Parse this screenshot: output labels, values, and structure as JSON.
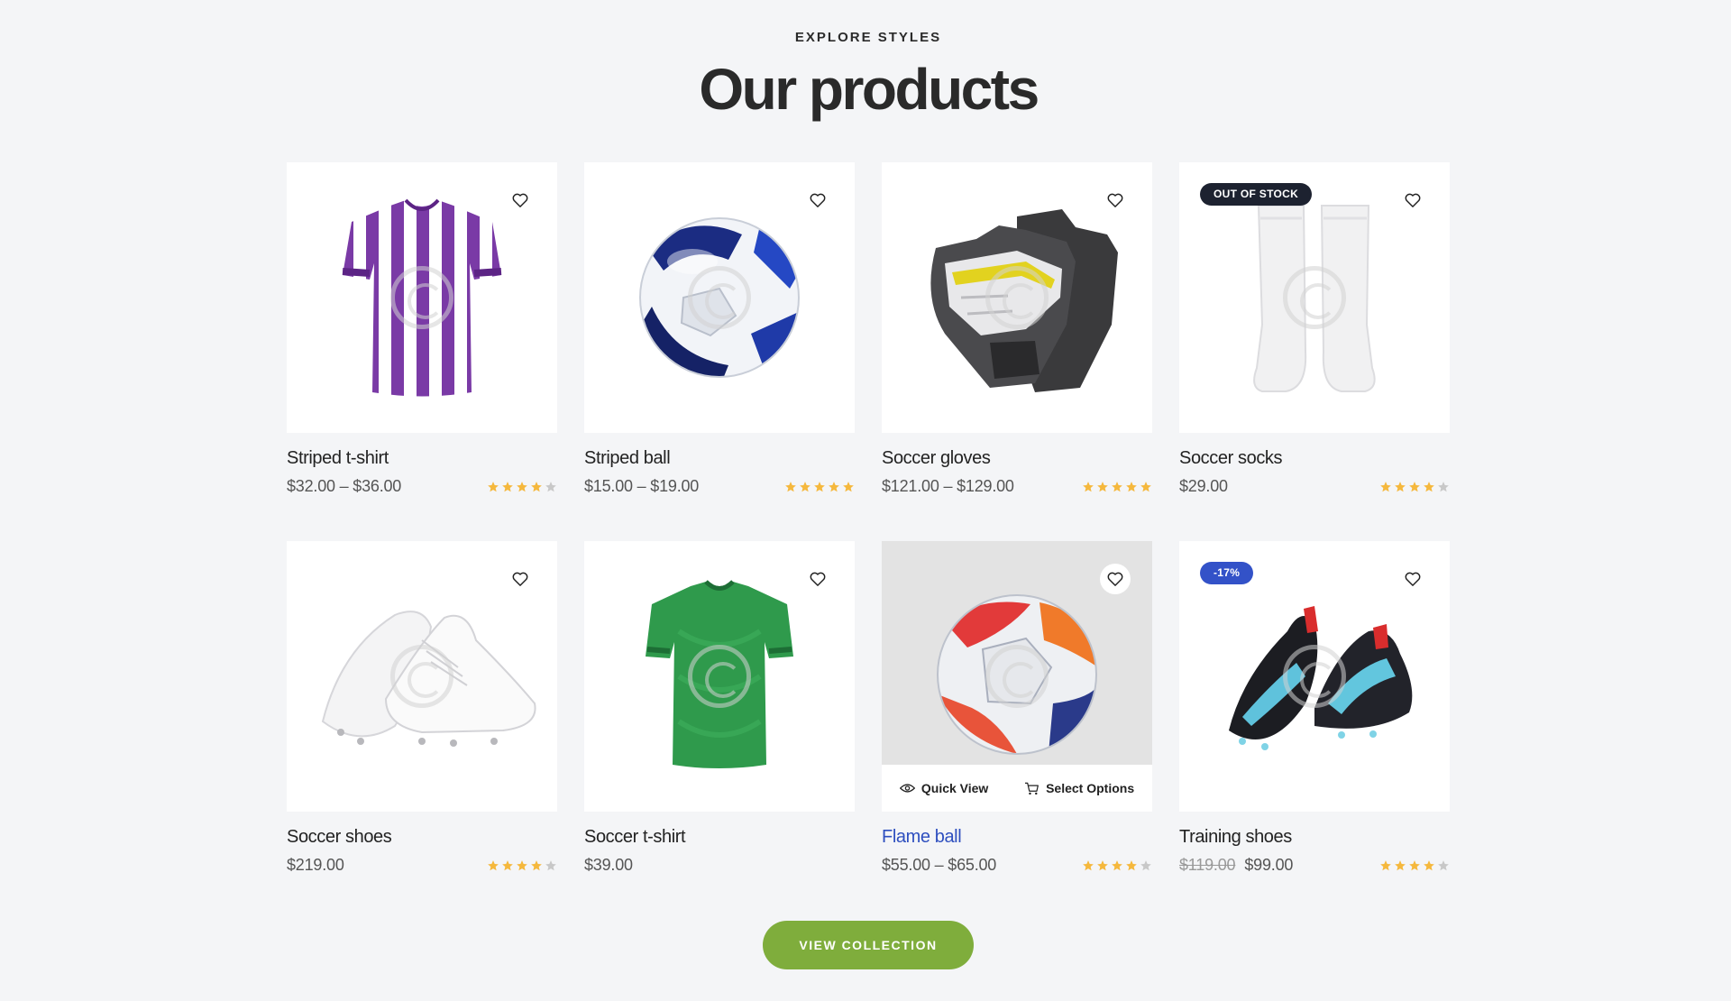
{
  "section": {
    "eyebrow": "EXPLORE STYLES",
    "heading": "Our products"
  },
  "colors": {
    "accent_green": "#7fad3c",
    "link_blue": "#2e4fbf",
    "star_gold": "#f5b83d",
    "star_empty": "#c8c8c8"
  },
  "products": [
    {
      "title": "Striped t-shirt",
      "price": "$32.00 – $36.00",
      "rating": 4
    },
    {
      "title": "Striped ball",
      "price": "$15.00 – $19.00",
      "rating": 5
    },
    {
      "title": "Soccer gloves",
      "price": "$121.00 – $129.00",
      "rating": 5
    },
    {
      "title": "Soccer socks",
      "price": "$29.00",
      "rating": 4,
      "badge": "OUT OF STOCK"
    },
    {
      "title": "Soccer shoes",
      "price": "$219.00",
      "rating": 4
    },
    {
      "title": "Soccer t-shirt",
      "price": "$39.00"
    },
    {
      "title": "Flame ball",
      "price": "$55.00 – $65.00",
      "rating": 4,
      "quick_view": "Quick View",
      "select_options": "Select Options"
    },
    {
      "title": "Training shoes",
      "old_price": "$119.00",
      "price": "$99.00",
      "rating": 4,
      "badge": "-17%"
    }
  ],
  "cta": {
    "label": "VIEW COLLECTION"
  }
}
